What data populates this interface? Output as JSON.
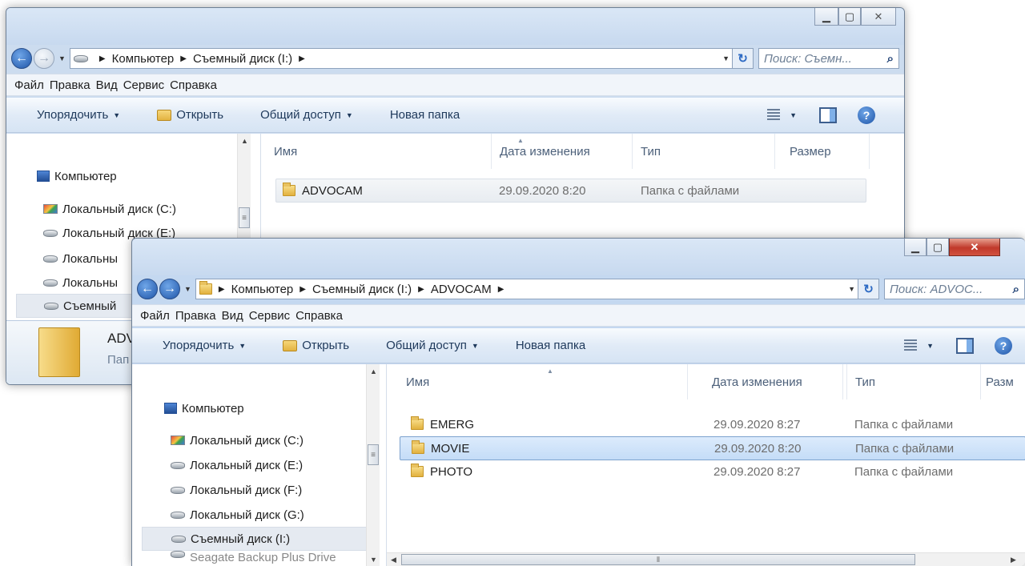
{
  "back_window": {
    "address": {
      "segments": [
        "Компьютер",
        "Съемный диск (I:)"
      ]
    },
    "search_placeholder": "Поиск: Съемн...",
    "menu": [
      "Файл",
      "Правка",
      "Вид",
      "Сервис",
      "Справка"
    ],
    "toolbar": {
      "organize": "Упорядочить",
      "open": "Открыть",
      "share": "Общий доступ",
      "new_folder": "Новая папка"
    },
    "columns": {
      "name": "Имя",
      "date": "Дата изменения",
      "type": "Тип",
      "size": "Размер"
    },
    "files": [
      {
        "name": "ADVOCAM",
        "date": "29.09.2020 8:20",
        "type": "Папка с файлами"
      }
    ],
    "nav": [
      "Компьютер",
      "Локальный диск (C:)",
      "Локальный диск (E:)",
      "Локальны",
      "Локальны",
      "Съемный"
    ],
    "details": {
      "name": "ADV",
      "type": "Пап"
    }
  },
  "front_window": {
    "address": {
      "segments": [
        "Компьютер",
        "Съемный диск (I:)",
        "ADVOCAM"
      ]
    },
    "search_placeholder": "Поиск: ADVOC...",
    "menu": [
      "Файл",
      "Правка",
      "Вид",
      "Сервис",
      "Справка"
    ],
    "toolbar": {
      "organize": "Упорядочить",
      "open": "Открыть",
      "share": "Общий доступ",
      "new_folder": "Новая папка"
    },
    "columns": {
      "name": "Имя",
      "date": "Дата изменения",
      "type": "Тип",
      "size": "Разм"
    },
    "files": [
      {
        "name": "EMERG",
        "date": "29.09.2020 8:27",
        "type": "Папка с файлами"
      },
      {
        "name": "MOVIE",
        "date": "29.09.2020 8:20",
        "type": "Папка с файлами"
      },
      {
        "name": "PHOTO",
        "date": "29.09.2020 8:27",
        "type": "Папка с файлами"
      }
    ],
    "nav": [
      "Компьютер",
      "Локальный диск (C:)",
      "Локальный диск (E:)",
      "Локальный диск (F:)",
      "Локальный диск (G:)",
      "Съемный диск (I:)",
      "Seagate Backup Plus Drive"
    ]
  },
  "icons": {
    "minimize": "minimize-icon",
    "maximize": "maximize-icon",
    "close": "close-icon",
    "folder": "folder-icon",
    "drive": "drive-icon",
    "computer": "computer-icon",
    "search": "search-icon",
    "refresh": "refresh-icon",
    "help": "help-icon"
  }
}
